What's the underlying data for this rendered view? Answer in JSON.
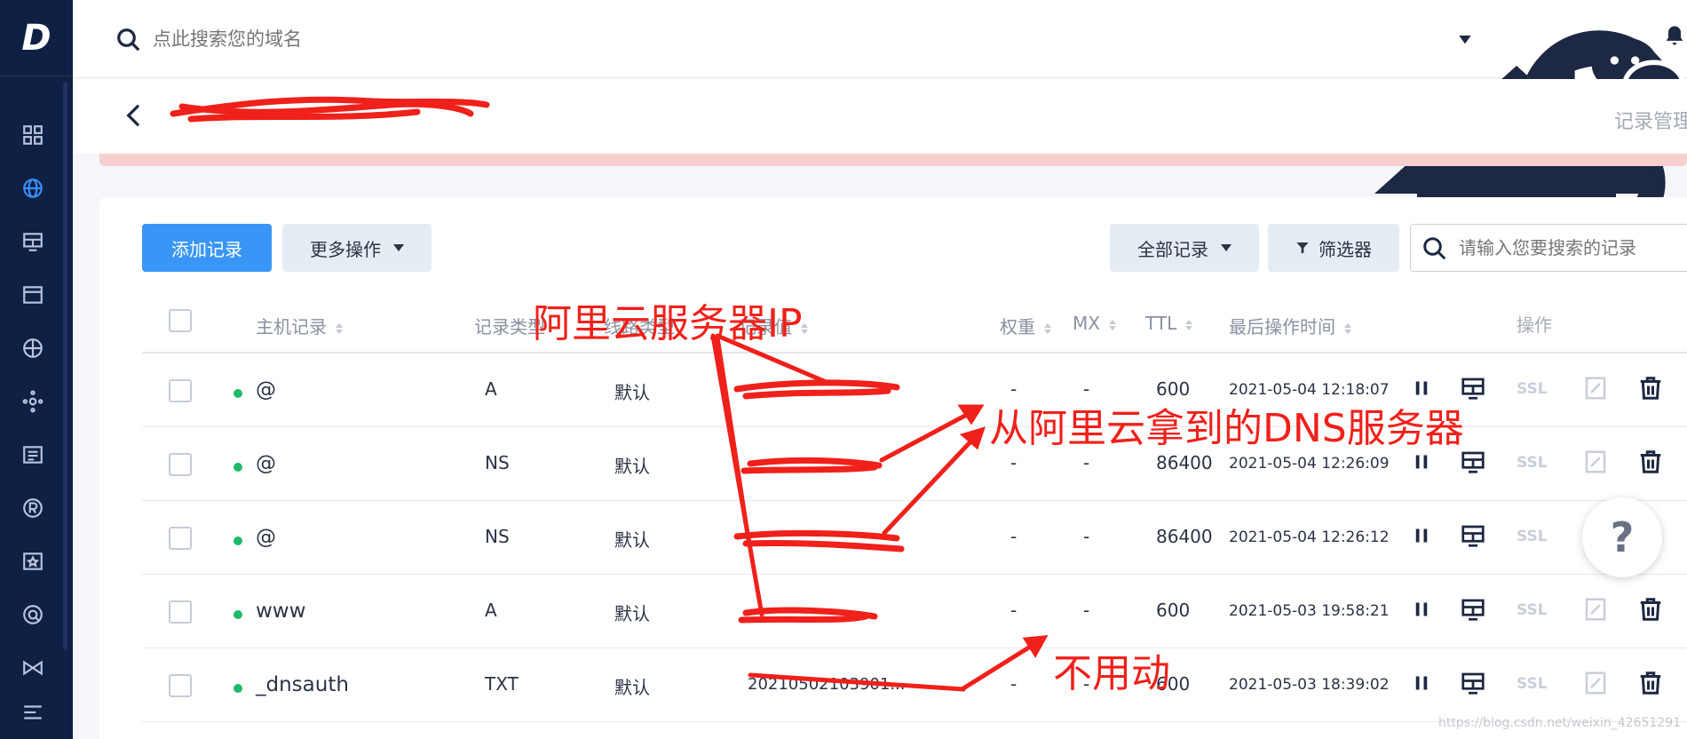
{
  "app": {
    "logo_letter": "D"
  },
  "topbar": {
    "search_placeholder": "点此搜索您的域名",
    "icons": [
      "home-icon",
      "cloud-icon",
      "help-icon",
      "wechat-icon",
      "bell-icon"
    ]
  },
  "subbar": {
    "domain_title": "",
    "right_label": "记录管理"
  },
  "sidebar": {
    "items": [
      "dashboard-icon",
      "globe-icon",
      "monitor-icon",
      "window-icon",
      "network-icon",
      "node-icon",
      "list-icon",
      "registered-icon",
      "star-box-icon",
      "shield-icon",
      "transfer-icon",
      "menu-icon"
    ]
  },
  "toolbar": {
    "add_record": "添加记录",
    "more_actions": "更多操作",
    "all_records": "全部记录",
    "filter": "筛选器",
    "search_placeholder": "请输入您要搜索的记录"
  },
  "table": {
    "headers": {
      "host": "主机记录",
      "type": "记录类型",
      "line": "线路类型",
      "value": "记录值",
      "weight": "权重",
      "mx": "MX",
      "ttl": "TTL",
      "last_op": "最后操作时间",
      "actions": "操作"
    },
    "rows": [
      {
        "host": "@",
        "type": "A",
        "line": "默认",
        "value": "",
        "weight": "-",
        "mx": "-",
        "ttl": "600",
        "time": "2021-05-04 12:18:07",
        "ssl": "SSL"
      },
      {
        "host": "@",
        "type": "NS",
        "line": "默认",
        "value": "",
        "weight": "-",
        "mx": "-",
        "ttl": "86400",
        "time": "2021-05-04 12:26:09",
        "ssl": "SSL"
      },
      {
        "host": "@",
        "type": "NS",
        "line": "默认",
        "value": "",
        "weight": "-",
        "mx": "-",
        "ttl": "86400",
        "time": "2021-05-04 12:26:12",
        "ssl": "SSL"
      },
      {
        "host": "www",
        "type": "A",
        "line": "默认",
        "value": "",
        "weight": "-",
        "mx": "-",
        "ttl": "600",
        "time": "2021-05-03 19:58:21",
        "ssl": "SSL"
      },
      {
        "host": "_dnsauth",
        "type": "TXT",
        "line": "默认",
        "value": "20210502103901...",
        "weight": "-",
        "mx": "-",
        "ttl": "600",
        "time": "2021-05-03 18:39:02",
        "ssl": "SSL"
      }
    ]
  },
  "annotations": {
    "aliyun_ip": "阿里云服务器IP",
    "aliyun_dns": "从阿里云拿到的DNS服务器",
    "no_change": "不用动"
  },
  "help_bubble": "?",
  "watermark": "https://blog.csdn.net/weixin_42651291",
  "colors": {
    "sidebar": "#0f2045",
    "primary": "#3a96f6",
    "status_green": "#21b96b",
    "annotation_red": "#f0201a"
  }
}
